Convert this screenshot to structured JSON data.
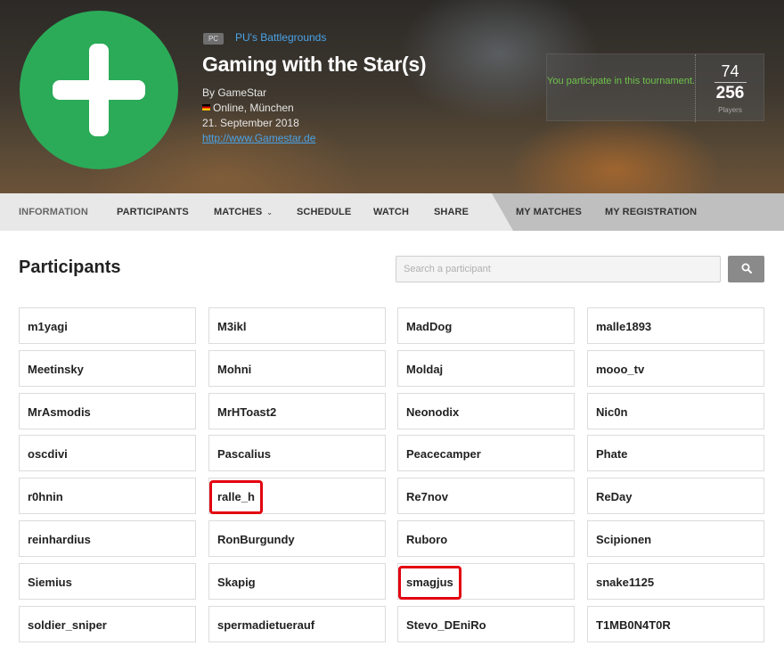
{
  "header": {
    "platform_badge": "PC",
    "game": "PU's Battlegrounds",
    "title": "Gaming with the Star(s)",
    "organizer": "By GameStar",
    "location": "Online, München",
    "date": "21. September 2018",
    "website": "http://www.Gamestar.de",
    "participation_message": "You participate in this tournament.",
    "participants_count": "74",
    "players_max": "256",
    "players_label": "Players"
  },
  "nav": {
    "items": [
      "INFORMATION",
      "PARTICIPANTS",
      "MATCHES",
      "SCHEDULE",
      "WATCH",
      "SHARE",
      "MY MATCHES",
      "MY REGISTRATION"
    ],
    "active": "INFORMATION"
  },
  "main": {
    "section_title": "Participants",
    "search_placeholder": "Search a participant",
    "participants": [
      [
        "m1yagi",
        "M3ikl",
        "MadDog",
        "malle1893"
      ],
      [
        "Meetinsky",
        "Mohni",
        "Moldaj",
        "mooo_tv"
      ],
      [
        "MrAsmodis",
        "MrHToast2",
        "Neonodix",
        "Nic0n"
      ],
      [
        "oscdivi",
        "Pascalius",
        "Peacecamper",
        "Phate"
      ],
      [
        "r0hnin",
        "ralle_h",
        "Re7nov",
        "ReDay"
      ],
      [
        "reinhardius",
        "RonBurgundy",
        "Ruboro",
        "Scipionen"
      ],
      [
        "Siemius",
        "Skapig",
        "smagjus",
        "snake1125"
      ],
      [
        "soldier_sniper",
        "spermadietuerauf",
        "Stevo_DEniRo",
        "T1MB0N4T0R"
      ]
    ],
    "highlighted": [
      "ralle_h",
      "smagjus"
    ]
  },
  "colors": {
    "logo_green": "#2bab58",
    "link_blue": "#4aa3e8",
    "participate_green": "#6fc24a",
    "highlight_red": "#e3000f"
  }
}
